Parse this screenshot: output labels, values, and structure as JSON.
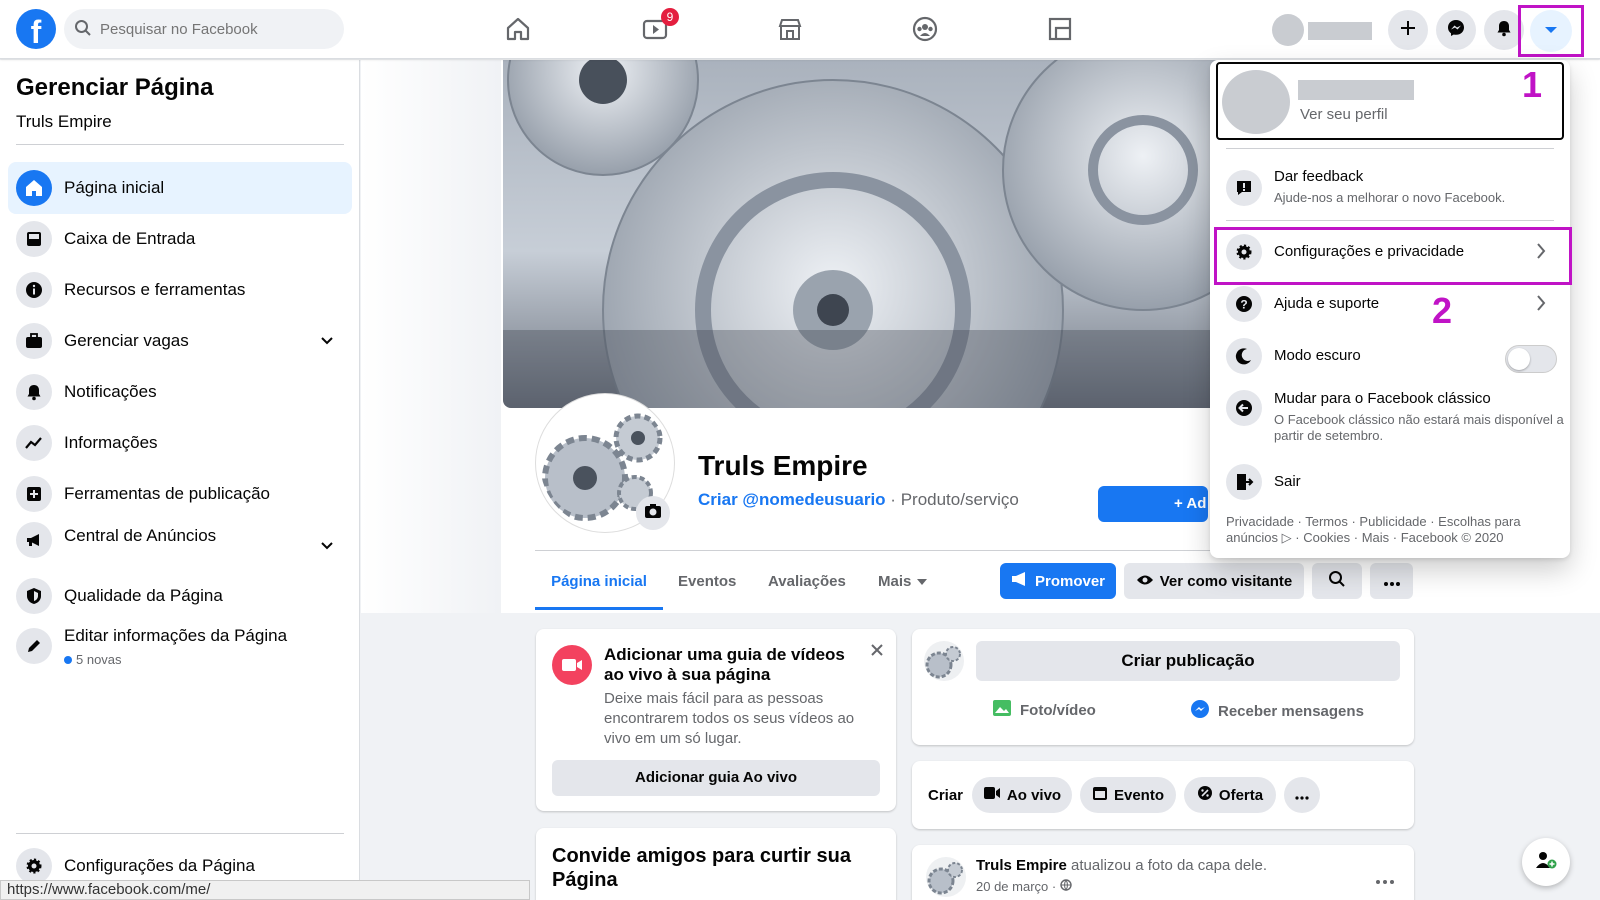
{
  "topbar": {
    "search_placeholder": "Pesquisar no Facebook",
    "watch_badge": "9"
  },
  "sidebar": {
    "title": "Gerenciar Página",
    "page_name": "Truls Empire",
    "items": [
      {
        "label": "Página inicial",
        "icon": "home-icon",
        "active": true
      },
      {
        "label": "Caixa de Entrada",
        "icon": "inbox-icon"
      },
      {
        "label": "Recursos e ferramentas",
        "icon": "info-icon"
      },
      {
        "label": "Gerenciar vagas",
        "icon": "briefcase-icon"
      },
      {
        "label": "Notificações",
        "icon": "bell-icon"
      },
      {
        "label": "Informações",
        "icon": "insights-icon"
      },
      {
        "label": "Ferramentas de publicação",
        "icon": "publishing-tools-icon"
      },
      {
        "label": "Central de Anúncios",
        "icon": "megaphone-icon"
      },
      {
        "label": "Qualidade da Página",
        "icon": "shield-icon"
      },
      {
        "label": "Editar informações da Página",
        "icon": "pencil-icon",
        "sub": "5 novas"
      }
    ],
    "settings_label": "Configurações da Página"
  },
  "status_url": "https://www.facebook.com/me/",
  "page": {
    "name": "Truls Empire",
    "username_link": "Criar @nomedeusuario",
    "separator": " · ",
    "category": "Produto/serviço",
    "add_button": "+ Ad",
    "tabs": [
      "Página inicial",
      "Eventos",
      "Avaliações",
      "Mais"
    ],
    "promote": "Promover",
    "view_as": "Ver como visitante"
  },
  "live_card": {
    "title": "Adicionar uma guia de vídeos ao vivo à sua página",
    "text": "Deixe mais fácil para as pessoas encontrarem todos os seus vídeos ao vivo em um só lugar.",
    "button": "Adicionar guia Ao vivo"
  },
  "invite_card": {
    "title": "Convide amigos para curtir sua Página"
  },
  "composer": {
    "create_post": "Criar publicação",
    "photo_video": "Foto/vídeo",
    "messages": "Receber mensagens"
  },
  "create_bar": {
    "label": "Criar",
    "live": "Ao vivo",
    "event": "Evento",
    "offer": "Oferta"
  },
  "post": {
    "author": "Truls Empire",
    "action": "atualizou a foto da capa dele.",
    "date": "20 de março · "
  },
  "dropdown": {
    "view_profile": "Ver seu perfil",
    "feedback_title": "Dar feedback",
    "feedback_desc": "Ajude-nos a melhorar o novo Facebook.",
    "settings": "Configurações e privacidade",
    "help": "Ajuda e suporte",
    "dark_mode": "Modo escuro",
    "classic_title": "Mudar para o Facebook clássico",
    "classic_desc": "O Facebook clássico não estará mais disponível a partir de setembro.",
    "logout": "Sair",
    "footer": "Privacidade · Termos · Publicidade · Escolhas para anúncios ▷ · Cookies · Mais · Facebook © 2020",
    "dark_mode_on": false
  },
  "annotations": {
    "one": "1",
    "two": "2"
  },
  "colors": {
    "brand": "#1877f2",
    "highlight": "#c013c6",
    "live": "#f3425f"
  }
}
